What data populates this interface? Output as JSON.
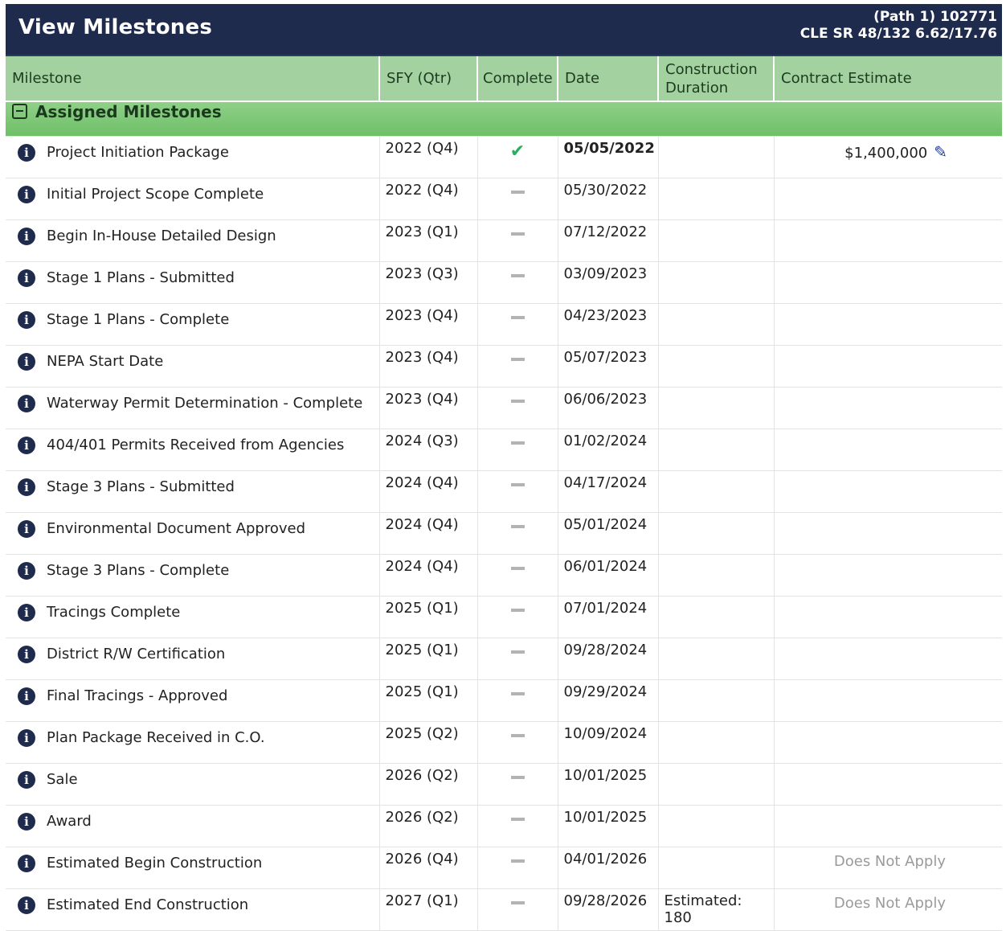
{
  "header": {
    "title": "View Milestones",
    "path_line1": "(Path 1) 102771",
    "path_line2": "CLE SR 48/132 6.62/17.76"
  },
  "columns": [
    "Milestone",
    "SFY (Qtr)",
    "Complete",
    "Date",
    "Construction Duration",
    "Contract Estimate"
  ],
  "group": {
    "label": "Assigned Milestones"
  },
  "rows": [
    {
      "name": "Project Initiation Package",
      "sfy": "2022 (Q4)",
      "complete": true,
      "date": "05/05/2022",
      "duration": "",
      "estimate": "$1,400,000"
    },
    {
      "name": "Initial Project Scope Complete",
      "sfy": "2022 (Q4)",
      "complete": false,
      "date": "05/30/2022",
      "duration": "",
      "estimate": ""
    },
    {
      "name": "Begin In-House Detailed Design",
      "sfy": "2023 (Q1)",
      "complete": false,
      "date": "07/12/2022",
      "duration": "",
      "estimate": ""
    },
    {
      "name": "Stage 1 Plans - Submitted",
      "sfy": "2023 (Q3)",
      "complete": false,
      "date": "03/09/2023",
      "duration": "",
      "estimate": ""
    },
    {
      "name": "Stage 1 Plans - Complete",
      "sfy": "2023 (Q4)",
      "complete": false,
      "date": "04/23/2023",
      "duration": "",
      "estimate": ""
    },
    {
      "name": "NEPA Start Date",
      "sfy": "2023 (Q4)",
      "complete": false,
      "date": "05/07/2023",
      "duration": "",
      "estimate": ""
    },
    {
      "name": "Waterway Permit Determination - Complete",
      "sfy": "2023 (Q4)",
      "complete": false,
      "date": "06/06/2023",
      "duration": "",
      "estimate": ""
    },
    {
      "name": "404/401 Permits Received from Agencies",
      "sfy": "2024 (Q3)",
      "complete": false,
      "date": "01/02/2024",
      "duration": "",
      "estimate": ""
    },
    {
      "name": "Stage 3 Plans - Submitted",
      "sfy": "2024 (Q4)",
      "complete": false,
      "date": "04/17/2024",
      "duration": "",
      "estimate": ""
    },
    {
      "name": "Environmental Document Approved",
      "sfy": "2024 (Q4)",
      "complete": false,
      "date": "05/01/2024",
      "duration": "",
      "estimate": ""
    },
    {
      "name": "Stage 3 Plans - Complete",
      "sfy": "2024 (Q4)",
      "complete": false,
      "date": "06/01/2024",
      "duration": "",
      "estimate": ""
    },
    {
      "name": "Tracings Complete",
      "sfy": "2025 (Q1)",
      "complete": false,
      "date": "07/01/2024",
      "duration": "",
      "estimate": ""
    },
    {
      "name": "District R/W Certification",
      "sfy": "2025 (Q1)",
      "complete": false,
      "date": "09/28/2024",
      "duration": "",
      "estimate": ""
    },
    {
      "name": "Final Tracings - Approved",
      "sfy": "2025 (Q1)",
      "complete": false,
      "date": "09/29/2024",
      "duration": "",
      "estimate": ""
    },
    {
      "name": "Plan Package Received in C.O.",
      "sfy": "2025 (Q2)",
      "complete": false,
      "date": "10/09/2024",
      "duration": "",
      "estimate": ""
    },
    {
      "name": "Sale",
      "sfy": "2026 (Q2)",
      "complete": false,
      "date": "10/01/2025",
      "duration": "",
      "estimate": ""
    },
    {
      "name": "Award",
      "sfy": "2026 (Q2)",
      "complete": false,
      "date": "10/01/2025",
      "duration": "",
      "estimate": ""
    },
    {
      "name": "Estimated Begin Construction",
      "sfy": "2026 (Q4)",
      "complete": false,
      "date": "04/01/2026",
      "duration": "",
      "estimate": "Does Not Apply"
    },
    {
      "name": "Estimated End Construction",
      "sfy": "2027 (Q1)",
      "complete": false,
      "date": "09/28/2026",
      "duration": "Estimated: 180",
      "estimate": "Does Not Apply"
    }
  ]
}
